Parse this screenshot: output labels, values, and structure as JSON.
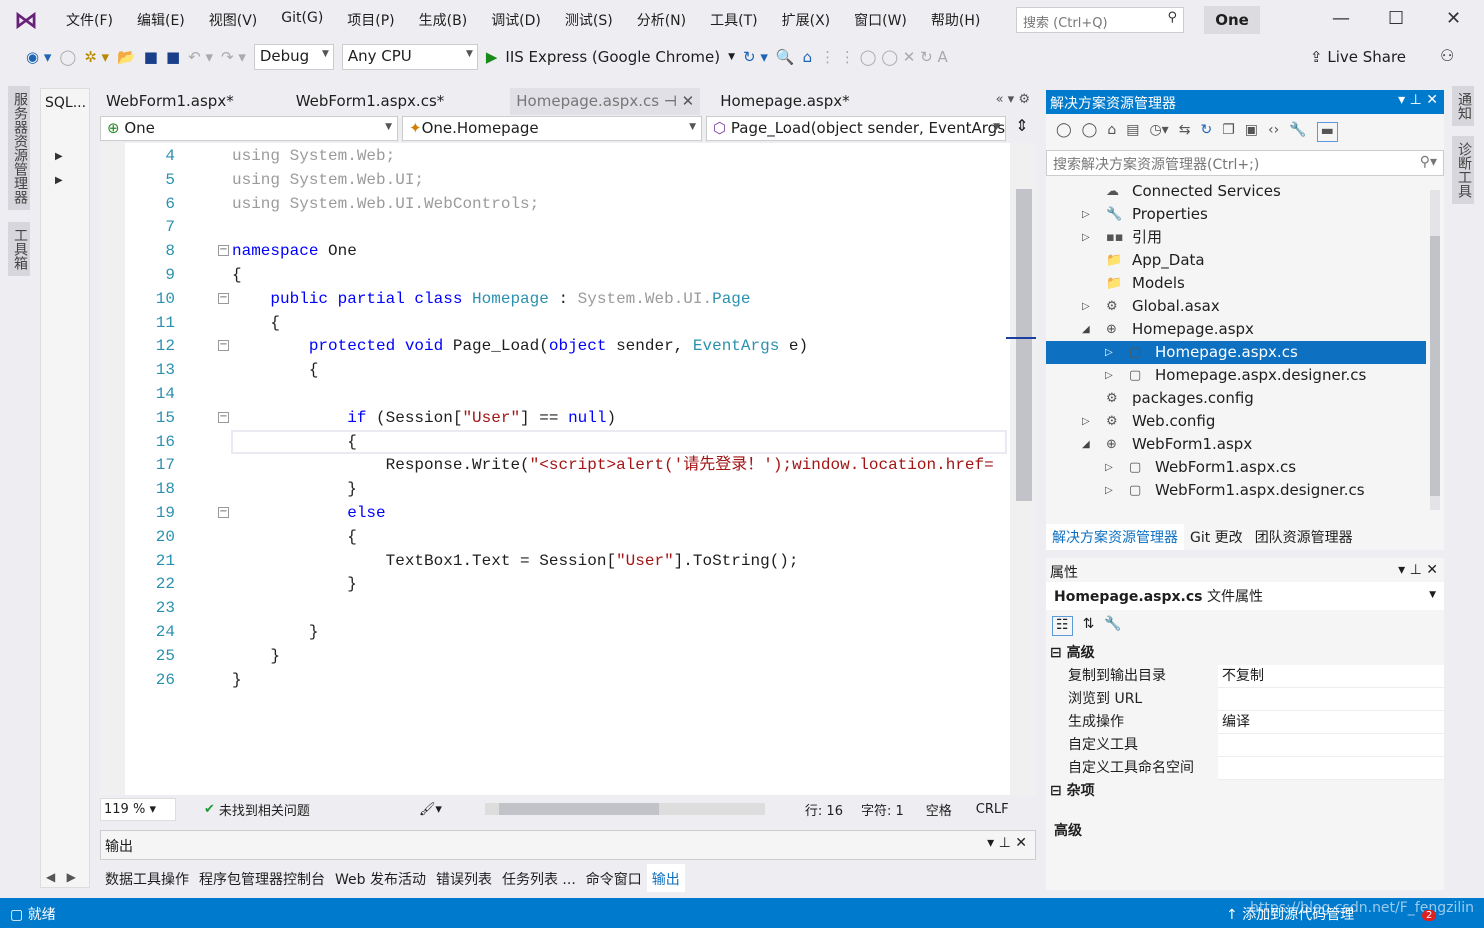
{
  "menubar": {
    "items": [
      "文件(F)",
      "编辑(E)",
      "视图(V)",
      "Git(G)",
      "项目(P)",
      "生成(B)",
      "调试(D)",
      "测试(S)",
      "分析(N)",
      "工具(T)",
      "扩展(X)",
      "窗口(W)",
      "帮助(H)"
    ],
    "search_placeholder": "搜索 (Ctrl+Q)",
    "solution_name": "One"
  },
  "toolbar": {
    "config": "Debug",
    "platform": "Any CPU",
    "run_target": "IIS Express (Google Chrome)",
    "live_share": "Live Share"
  },
  "left_strip": {
    "server_explorer": "服务器资源管理器",
    "toolbox": "工具箱"
  },
  "sql_panel": {
    "title": "SQL..."
  },
  "editor": {
    "tabs": [
      {
        "label": "WebForm1.aspx*"
      },
      {
        "label": "WebForm1.aspx.cs*"
      },
      {
        "label": "Homepage.aspx.cs",
        "active": true
      },
      {
        "label": "Homepage.aspx*"
      }
    ],
    "nav": {
      "project": "One",
      "class": "One.Homepage",
      "member": "Page_Load(object sender, EventArgs e)"
    },
    "lines": [
      {
        "n": "4",
        "tokens": [
          [
            "using System.Web;",
            "g"
          ]
        ]
      },
      {
        "n": "5",
        "tokens": [
          [
            "using System.Web.UI;",
            "g"
          ]
        ]
      },
      {
        "n": "6",
        "tokens": [
          [
            "using System.Web.UI.WebControls;",
            "g"
          ]
        ]
      },
      {
        "n": "7",
        "tokens": []
      },
      {
        "n": "8",
        "fold": true,
        "tokens": [
          [
            "namespace",
            "k"
          ],
          [
            " One",
            "p"
          ]
        ]
      },
      {
        "n": "9",
        "tokens": [
          [
            "{",
            "p"
          ]
        ]
      },
      {
        "n": "10",
        "fold": true,
        "tokens": [
          [
            "    public partial class ",
            "k"
          ],
          [
            "Homepage",
            "t"
          ],
          [
            " : ",
            "p"
          ],
          [
            "System.Web.UI.",
            "g"
          ],
          [
            "Page",
            "t"
          ]
        ]
      },
      {
        "n": "11",
        "tokens": [
          [
            "    {",
            "p"
          ]
        ]
      },
      {
        "n": "12",
        "fold": true,
        "tokens": [
          [
            "        protected void ",
            "k"
          ],
          [
            "Page_Load(",
            "p"
          ],
          [
            "object",
            "k"
          ],
          [
            " sender, ",
            "p"
          ],
          [
            "EventArgs",
            "t"
          ],
          [
            " e)",
            "p"
          ]
        ]
      },
      {
        "n": "13",
        "tokens": [
          [
            "        {",
            "p"
          ]
        ]
      },
      {
        "n": "14",
        "tokens": []
      },
      {
        "n": "15",
        "fold": true,
        "tokens": [
          [
            "            if",
            "k"
          ],
          [
            " (Session[",
            "p"
          ],
          [
            "\"User\"",
            "s"
          ],
          [
            "] == ",
            "p"
          ],
          [
            "null",
            "k"
          ],
          [
            ")",
            "p"
          ]
        ]
      },
      {
        "n": "16",
        "tokens": [
          [
            "            {",
            "p"
          ]
        ]
      },
      {
        "n": "17",
        "tokens": [
          [
            "                Response.Write(",
            "p"
          ],
          [
            "\"<script>alert('请先登录！');window.location.href=",
            "s"
          ]
        ]
      },
      {
        "n": "18",
        "tokens": [
          [
            "            }",
            "p"
          ]
        ]
      },
      {
        "n": "19",
        "fold": true,
        "tokens": [
          [
            "            else",
            "k"
          ]
        ]
      },
      {
        "n": "20",
        "tokens": [
          [
            "            {",
            "p"
          ]
        ]
      },
      {
        "n": "21",
        "tokens": [
          [
            "                TextBox1.Text = Session[",
            "p"
          ],
          [
            "\"User\"",
            "s"
          ],
          [
            "].ToString();",
            "p"
          ]
        ]
      },
      {
        "n": "22",
        "tokens": [
          [
            "            }",
            "p"
          ]
        ]
      },
      {
        "n": "23",
        "tokens": []
      },
      {
        "n": "24",
        "tokens": [
          [
            "        }",
            "p"
          ]
        ]
      },
      {
        "n": "25",
        "tokens": [
          [
            "    }",
            "p"
          ]
        ]
      },
      {
        "n": "26",
        "tokens": [
          [
            "}",
            "p"
          ]
        ]
      }
    ],
    "status": {
      "zoom": "119 %",
      "issues": "未找到相关问题",
      "line": "行: 16",
      "char": "字符: 1",
      "spaces": "空格",
      "eol": "CRLF"
    }
  },
  "output": {
    "title": "输出"
  },
  "bottom_tabs": [
    {
      "label": "数据工具操作"
    },
    {
      "label": "程序包管理器控制台"
    },
    {
      "label": "Web 发布活动"
    },
    {
      "label": "错误列表"
    },
    {
      "label": "任务列表 ..."
    },
    {
      "label": "命令窗口"
    },
    {
      "label": "输出",
      "active": true
    }
  ],
  "statusbar": {
    "ready": "就绪",
    "source_control": "添加到源代码管理",
    "notifications": "2",
    "watermark": "https://blog.csdn.net/F_fengzilin"
  },
  "solution_explorer": {
    "title": "解决方案资源管理器",
    "search_placeholder": "搜索解决方案资源管理器(Ctrl+;)",
    "items": [
      {
        "label": "Connected Services",
        "level": 1,
        "icon": "cloud-icon"
      },
      {
        "label": "Properties",
        "level": 1,
        "exp": "collapsed",
        "icon": "wrench-icon"
      },
      {
        "label": "引用",
        "level": 1,
        "exp": "collapsed",
        "icon": "references-icon"
      },
      {
        "label": "App_Data",
        "level": 1,
        "icon": "folder-icon"
      },
      {
        "label": "Models",
        "level": 1,
        "icon": "folder-icon"
      },
      {
        "label": "Global.asax",
        "level": 1,
        "exp": "collapsed",
        "icon": "gear-file-icon"
      },
      {
        "label": "Homepage.aspx",
        "level": 1,
        "exp": "expanded",
        "icon": "web-file-icon"
      },
      {
        "label": "Homepage.aspx.cs",
        "level": 2,
        "exp": "collapsed",
        "icon": "cs-file-icon",
        "selected": true
      },
      {
        "label": "Homepage.aspx.designer.cs",
        "level": 2,
        "exp": "collapsed",
        "icon": "cs-file-icon"
      },
      {
        "label": "packages.config",
        "level": 1,
        "icon": "config-file-icon"
      },
      {
        "label": "Web.config",
        "level": 1,
        "exp": "collapsed",
        "icon": "config-file-icon"
      },
      {
        "label": "WebForm1.aspx",
        "level": 1,
        "exp": "expanded",
        "icon": "web-file-icon"
      },
      {
        "label": "WebForm1.aspx.cs",
        "level": 2,
        "exp": "collapsed",
        "icon": "cs-file-icon"
      },
      {
        "label": "WebForm1.aspx.designer.cs",
        "level": 2,
        "exp": "collapsed",
        "icon": "cs-file-icon"
      }
    ],
    "tabs": [
      {
        "label": "解决方案资源管理器",
        "active": true
      },
      {
        "label": "Git 更改"
      },
      {
        "label": "团队资源管理器"
      }
    ]
  },
  "properties": {
    "title": "属性",
    "object": "Homepage.aspx.cs",
    "object_type": "文件属性",
    "sections": [
      {
        "name": "高级",
        "rows": [
          [
            "复制到输出目录",
            "不复制"
          ],
          [
            "浏览到 URL",
            ""
          ],
          [
            "生成操作",
            "编译"
          ],
          [
            "自定义工具",
            ""
          ],
          [
            "自定义工具命名空间",
            ""
          ]
        ]
      },
      {
        "name": "杂项",
        "rows": []
      }
    ],
    "description_title": "高级"
  },
  "right_strip": {
    "notifications": "通知",
    "diagnostics": "诊断工具"
  }
}
